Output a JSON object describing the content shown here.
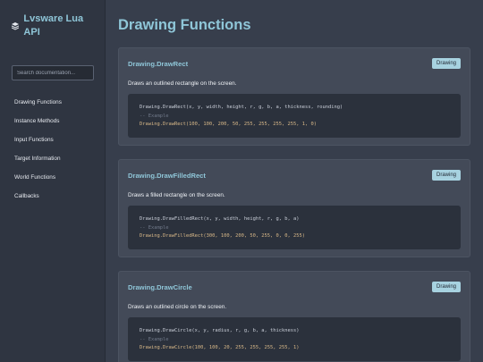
{
  "sidebar": {
    "title": "Lvsware Lua API",
    "logo_icon": "layers-icon",
    "search_placeholder": "Search documentation...",
    "items": [
      {
        "label": "Drawing Functions"
      },
      {
        "label": "Instance Methods"
      },
      {
        "label": "Input Functions"
      },
      {
        "label": "Target Information"
      },
      {
        "label": "World Functions"
      },
      {
        "label": "Callbacks"
      }
    ]
  },
  "main": {
    "title": "Drawing Functions",
    "cards": [
      {
        "title": "Drawing.DrawRect",
        "tag": "Drawing",
        "description": "Draws an outlined rectangle on the screen.",
        "signature": "Drawing.DrawRect(x, y, width, height, r, g, b, a, thickness, rounding)",
        "comment": "-- Example",
        "example": "Drawing.DrawRect(100, 100, 200, 50, 255, 255, 255, 255, 1, 0)"
      },
      {
        "title": "Drawing.DrawFilledRect",
        "tag": "Drawing",
        "description": "Draws a filled rectangle on the screen.",
        "signature": "Drawing.DrawFilledRect(x, y, width, height, r, g, b, a)",
        "comment": "-- Example",
        "example": "Drawing.DrawFilledRect(300, 100, 200, 50, 255, 0, 0, 255)"
      },
      {
        "title": "Drawing.DrawCircle",
        "tag": "Drawing",
        "description": "Draws an outlined circle on the screen.",
        "signature": "Drawing.DrawCircle(x, y, radius, r, g, b, a, thickness)",
        "comment": "-- Example",
        "example": "Drawing.DrawCircle(100, 100, 20, 255, 255, 255, 255, 1)"
      }
    ]
  }
}
